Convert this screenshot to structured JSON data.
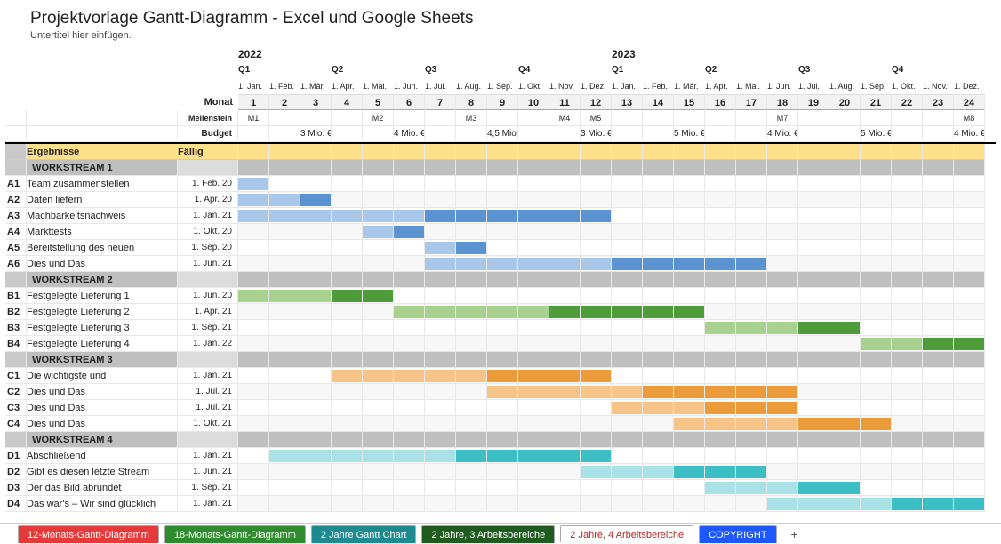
{
  "header": {
    "title": "Projektvorlage Gantt-Diagramm - Excel und Google Sheets",
    "subtitle": "Untertitel hier einfügen."
  },
  "labels": {
    "monat": "Monat",
    "meilenstein": "Meilenstein",
    "budget": "Budget",
    "ergebnisse": "Ergebnisse",
    "faellig": "Fällig"
  },
  "timeline": {
    "years": [
      "2022",
      "2023"
    ],
    "quarters": [
      "Q1",
      "Q2",
      "Q3",
      "Q4",
      "Q1",
      "Q2",
      "Q3",
      "Q4"
    ],
    "month_dates": [
      "1. Jan.",
      "1. Feb.",
      "1. Mär.",
      "1. Apr.",
      "1. Mai.",
      "1. Jun.",
      "1. Jul.",
      "1. Aug.",
      "1. Sep.",
      "1. Okt.",
      "1. Nov.",
      "1. Dez.",
      "1. Jan.",
      "1. Feb.",
      "1. Mär.",
      "1. Apr.",
      "1. Mai.",
      "1. Jun.",
      "1. Jul.",
      "1. Aug.",
      "1. Sep.",
      "1. Okt.",
      "1. Nov.",
      "1. Dez."
    ],
    "month_nums": [
      "1",
      "2",
      "3",
      "4",
      "5",
      "6",
      "7",
      "8",
      "9",
      "10",
      "11",
      "12",
      "13",
      "14",
      "15",
      "16",
      "17",
      "18",
      "19",
      "20",
      "21",
      "22",
      "23",
      "24"
    ]
  },
  "milestones": {
    "1": "M1",
    "5": "M2",
    "8": "M3",
    "11": "M4",
    "12": "M5",
    "18": "M7",
    "24": "M8"
  },
  "budget": {
    "3": "3 Mio. €",
    "6": "4 Mio. €",
    "9": "4,5 Mio. €",
    "12": "3 Mio. €",
    "15": "5 Mio. €",
    "18": "4 Mio. €",
    "21": "5 Mio. €",
    "24": "4 Mio. €"
  },
  "workstreams": [
    {
      "name": "WORKSTREAM 1",
      "color": "blue",
      "tasks": [
        {
          "id": "A1",
          "name": "Team zusammenstellen",
          "due": "1. Feb. 20",
          "start": 1,
          "end": 1
        },
        {
          "id": "A2",
          "name": "Daten liefern",
          "due": "1. Apr. 20",
          "start": 1,
          "end": 3
        },
        {
          "id": "A3",
          "name": "Machbarkeitsnachweis",
          "due": "1. Jan. 21",
          "start": 1,
          "end": 12
        },
        {
          "id": "A4",
          "name": "Markttests",
          "due": "1. Okt. 20",
          "start": 5,
          "end": 6
        },
        {
          "id": "A5",
          "name": "Bereitstellung des neuen",
          "due": "1. Sep. 20",
          "start": 7,
          "end": 8
        },
        {
          "id": "A6",
          "name": "Dies und Das",
          "due": "1. Jun. 21",
          "start": 7,
          "end": 17
        }
      ]
    },
    {
      "name": "WORKSTREAM 2",
      "color": "green",
      "tasks": [
        {
          "id": "B1",
          "name": "Festgelegte Lieferung 1",
          "due": "1. Jun. 20",
          "start": 1,
          "end": 5
        },
        {
          "id": "B2",
          "name": "Festgelegte Lieferung 2",
          "due": "1. Apr. 21",
          "start": 6,
          "end": 15
        },
        {
          "id": "B3",
          "name": "Festgelegte Lieferung 3",
          "due": "1. Sep. 21",
          "start": 16,
          "end": 20
        },
        {
          "id": "B4",
          "name": "Festgelegte Lieferung 4",
          "due": "1. Jan. 22",
          "start": 21,
          "end": 24
        }
      ]
    },
    {
      "name": "WORKSTREAM 3",
      "color": "orange",
      "tasks": [
        {
          "id": "C1",
          "name": "Die wichtigste und",
          "due": "1. Jan. 21",
          "start": 4,
          "end": 12
        },
        {
          "id": "C2",
          "name": "Dies und Das",
          "due": "1. Jul. 21",
          "start": 9,
          "end": 18
        },
        {
          "id": "C3",
          "name": "Dies und Das",
          "due": "1. Jul. 21",
          "start": 13,
          "end": 18
        },
        {
          "id": "C4",
          "name": "Dies und Das",
          "due": "1. Okt. 21",
          "start": 15,
          "end": 21
        }
      ]
    },
    {
      "name": "WORKSTREAM 4",
      "color": "teal",
      "tasks": [
        {
          "id": "D1",
          "name": "Abschließend",
          "due": "1. Jan. 21",
          "start": 2,
          "end": 12
        },
        {
          "id": "D2",
          "name": "Gibt es diesen letzte Stream",
          "due": "1. Jun. 21",
          "start": 12,
          "end": 17
        },
        {
          "id": "D3",
          "name": "Der das Bild abrundet",
          "due": "1. Sep. 21",
          "start": 16,
          "end": 20
        },
        {
          "id": "D4",
          "name": "Das war's – Wir sind glücklich",
          "due": "1. Jan. 21",
          "start": 18,
          "end": 24
        }
      ]
    }
  ],
  "tabs": [
    {
      "label": "12-Monats-Gantt-Diagramm",
      "cls": "t-red"
    },
    {
      "label": "18-Monats-Gantt-Diagramm",
      "cls": "t-green"
    },
    {
      "label": "2 Jahre Gantt Chart",
      "cls": "t-teal"
    },
    {
      "label": "2 Jahre, 3 Arbeitsbereiche",
      "cls": "t-dgreen"
    },
    {
      "label": "2 Jahre, 4 Arbeitsbereiche",
      "cls": "t-active"
    },
    {
      "label": "COPYRIGHT",
      "cls": "t-blue"
    }
  ],
  "chart_data": {
    "type": "gantt",
    "title": "Projektvorlage Gantt-Diagramm - Excel und Google Sheets",
    "x_unit": "month",
    "x_range": [
      1,
      24
    ],
    "x_start_label": "1. Jan. 2022",
    "x_end_label": "1. Dez. 2023",
    "series": [
      {
        "group": "WORKSTREAM 1",
        "task": "A1 Team zusammenstellen",
        "start": 1,
        "end": 1
      },
      {
        "group": "WORKSTREAM 1",
        "task": "A2 Daten liefern",
        "start": 1,
        "end": 3
      },
      {
        "group": "WORKSTREAM 1",
        "task": "A3 Machbarkeitsnachweis",
        "start": 1,
        "end": 12
      },
      {
        "group": "WORKSTREAM 1",
        "task": "A4 Markttests",
        "start": 5,
        "end": 6
      },
      {
        "group": "WORKSTREAM 1",
        "task": "A5 Bereitstellung des neuen",
        "start": 7,
        "end": 8
      },
      {
        "group": "WORKSTREAM 1",
        "task": "A6 Dies und Das",
        "start": 7,
        "end": 17
      },
      {
        "group": "WORKSTREAM 2",
        "task": "B1 Festgelegte Lieferung 1",
        "start": 1,
        "end": 5
      },
      {
        "group": "WORKSTREAM 2",
        "task": "B2 Festgelegte Lieferung 2",
        "start": 6,
        "end": 15
      },
      {
        "group": "WORKSTREAM 2",
        "task": "B3 Festgelegte Lieferung 3",
        "start": 16,
        "end": 20
      },
      {
        "group": "WORKSTREAM 2",
        "task": "B4 Festgelegte Lieferung 4",
        "start": 21,
        "end": 24
      },
      {
        "group": "WORKSTREAM 3",
        "task": "C1 Die wichtigste und",
        "start": 4,
        "end": 12
      },
      {
        "group": "WORKSTREAM 3",
        "task": "C2 Dies und Das",
        "start": 9,
        "end": 18
      },
      {
        "group": "WORKSTREAM 3",
        "task": "C3 Dies und Das",
        "start": 13,
        "end": 18
      },
      {
        "group": "WORKSTREAM 3",
        "task": "C4 Dies und Das",
        "start": 15,
        "end": 21
      },
      {
        "group": "WORKSTREAM 4",
        "task": "D1 Abschließend",
        "start": 2,
        "end": 12
      },
      {
        "group": "WORKSTREAM 4",
        "task": "D2 Gibt es diesen letzte Stream",
        "start": 12,
        "end": 17
      },
      {
        "group": "WORKSTREAM 4",
        "task": "D3 Der das Bild abrundet",
        "start": 16,
        "end": 20
      },
      {
        "group": "WORKSTREAM 4",
        "task": "D4 Das war's – Wir sind glücklich",
        "start": 18,
        "end": 24
      }
    ],
    "milestones": [
      {
        "x": 1,
        "label": "M1"
      },
      {
        "x": 5,
        "label": "M2"
      },
      {
        "x": 8,
        "label": "M3"
      },
      {
        "x": 11,
        "label": "M4"
      },
      {
        "x": 12,
        "label": "M5"
      },
      {
        "x": 18,
        "label": "M7"
      },
      {
        "x": 24,
        "label": "M8"
      }
    ],
    "budget_by_quarter_eur_millions": [
      3,
      4,
      4.5,
      3,
      5,
      4,
      5,
      4
    ]
  }
}
